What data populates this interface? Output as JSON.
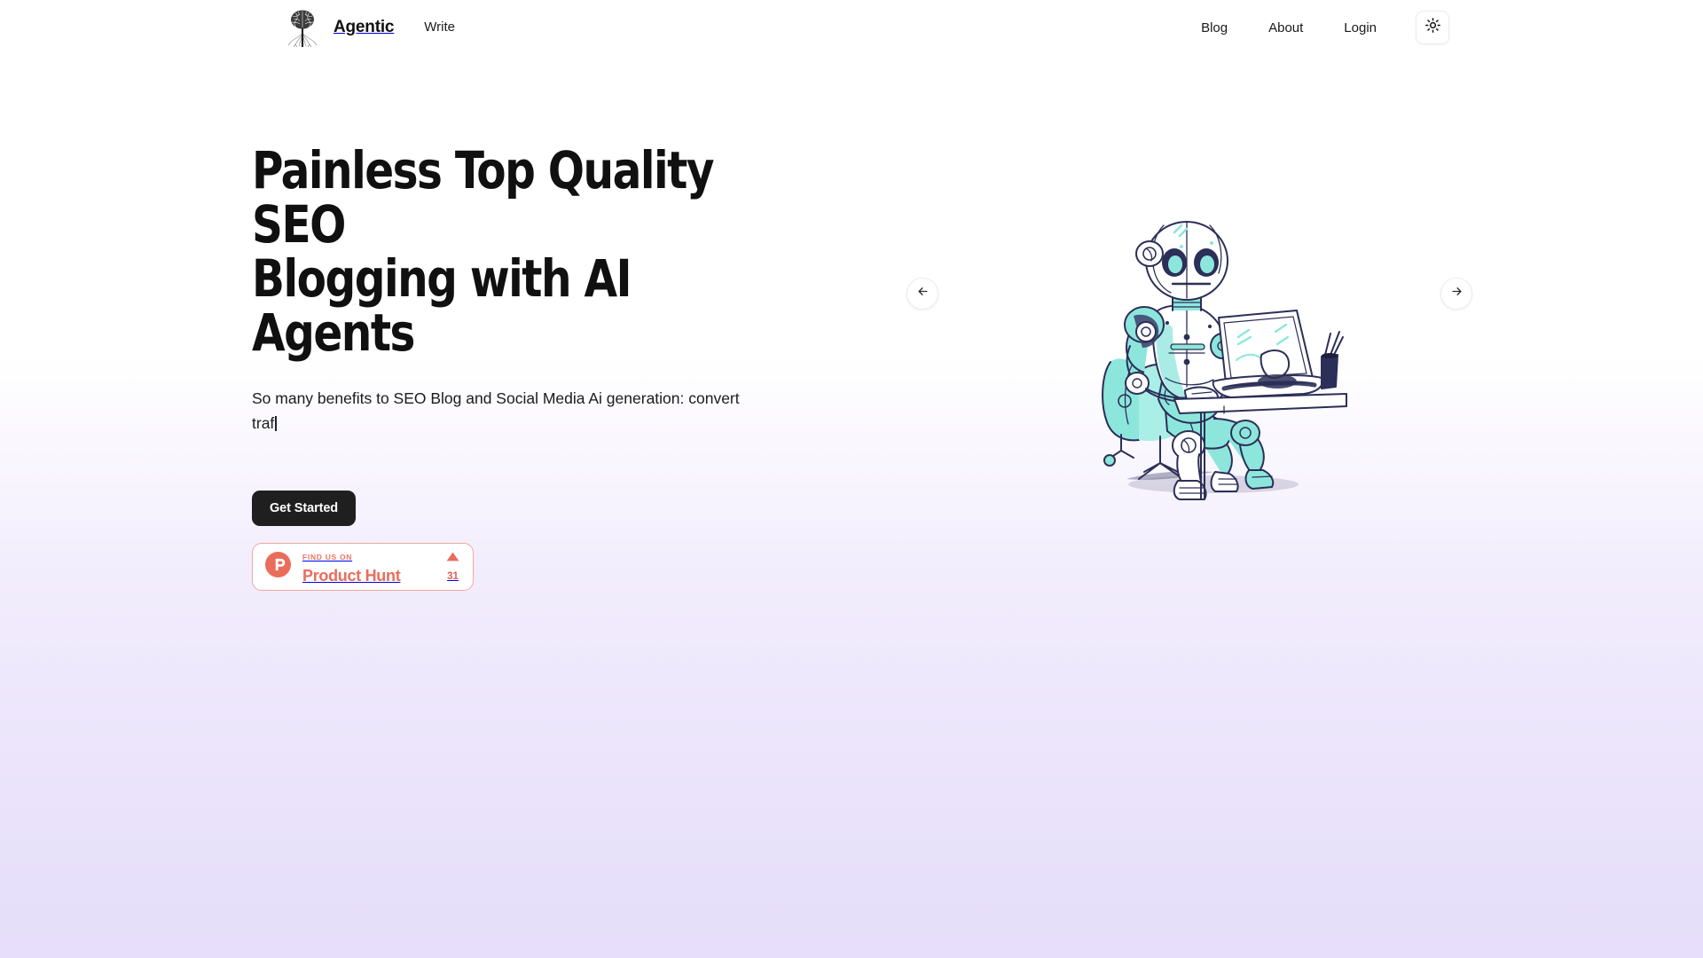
{
  "brand": {
    "name": "Agentic",
    "logo_icon": "brain-tree-icon"
  },
  "nav": {
    "primary": [
      {
        "label": "Write",
        "name": "nav-write"
      }
    ],
    "secondary": [
      {
        "label": "Blog",
        "name": "nav-blog"
      },
      {
        "label": "About",
        "name": "nav-about"
      },
      {
        "label": "Login",
        "name": "nav-login"
      }
    ],
    "theme_toggle_icon": "sun-icon"
  },
  "hero": {
    "title_line1": "Painless Top Quality SEO",
    "title_line2": "Blogging with AI Agents",
    "subtitle": "So many benefits to SEO Blog and Social Media Ai generation: convert traf",
    "typing_caret": true,
    "cta_label": "Get Started"
  },
  "product_hunt": {
    "kicker": "FIND US ON",
    "name": "Product Hunt",
    "upvote_icon": "triangle-up-icon",
    "upvote_count": "31",
    "accent_color": "#ea6d5b",
    "border_color": "#f0a79c"
  },
  "carousel": {
    "prev_icon": "arrow-left-icon",
    "next_icon": "arrow-right-icon",
    "slide_illustration": "robot-at-desk-illustration"
  },
  "colors": {
    "cta_background": "#1f1f1f",
    "page_gradient_top": "#ffffff",
    "page_gradient_bottom": "#e6defa",
    "robot_mint": "#7fe3d8",
    "robot_navy": "#2c2f57"
  }
}
